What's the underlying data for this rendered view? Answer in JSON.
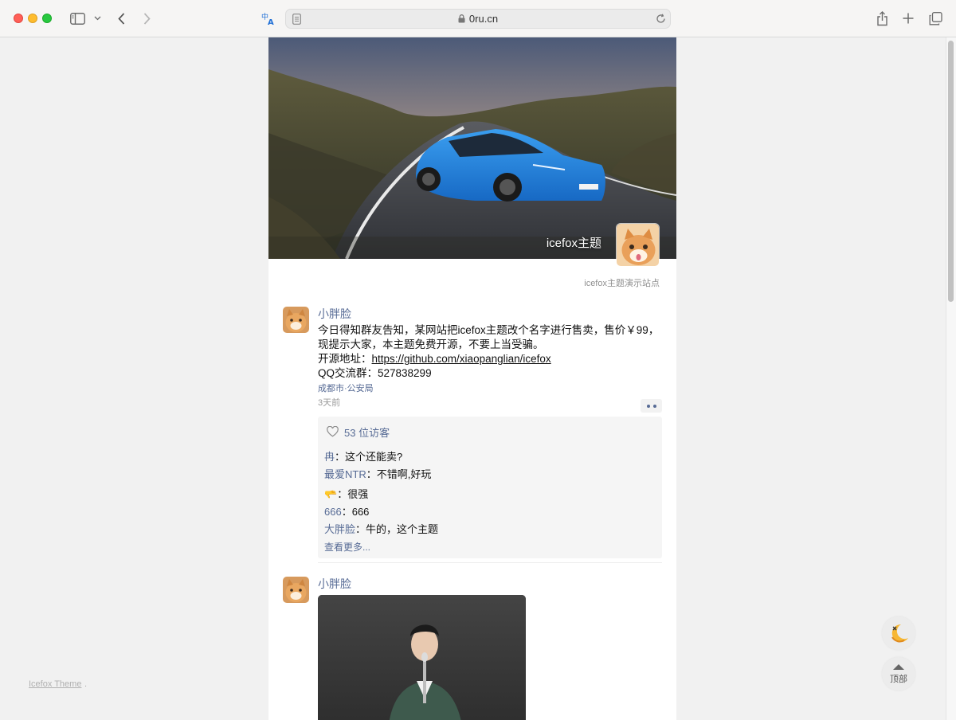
{
  "browser": {
    "url": "0ru.cn",
    "icons": [
      "sidebar-icon",
      "chevron-down-icon",
      "back-icon",
      "forward-icon",
      "translate-icon",
      "reader-icon",
      "lock-icon",
      "reload-icon",
      "share-icon",
      "new-tab-icon",
      "tabs-overview-icon"
    ]
  },
  "header": {
    "site_name": "icefox主题",
    "site_description": "icefox主题演示站点"
  },
  "posts": [
    {
      "author": "小胖脸",
      "content_lines": [
        "今日得知群友告知，某网站把icefox主题改个名字进行售卖，售价￥99，现提示大家，本主题免费开源，不要上当受骗。"
      ],
      "source_label": "开源地址：",
      "source_link": "https://github.com/xiaopanglian/icefox",
      "qq_line": "QQ交流群：527838299",
      "location": "成都市·公安局",
      "time": "3天前",
      "likes": "53 位访客",
      "comments": [
        {
          "name": "冉",
          "sep": "：",
          "text": "这个还能卖?"
        },
        {
          "name": "最爱NTR",
          "sep": "：",
          "text": "不错啊,好玩"
        },
        {
          "name": "🫳",
          "sep": "：",
          "text": "很强"
        },
        {
          "name": "666",
          "sep": "：",
          "text": "666"
        },
        {
          "name": "大胖脸",
          "sep": "：",
          "text": "牛的，这个主题"
        }
      ],
      "see_more": "查看更多..."
    },
    {
      "author": "小胖脸"
    }
  ],
  "footer": {
    "theme_link": "Icefox Theme",
    "dot": "."
  },
  "floating": {
    "dark_mode_icon": "moon-icon",
    "back_to_top": "顶部"
  },
  "colors": {
    "link_blue": "#576b95",
    "close": "#ff5f57",
    "minimize": "#febc2e",
    "maximize": "#28c840"
  }
}
